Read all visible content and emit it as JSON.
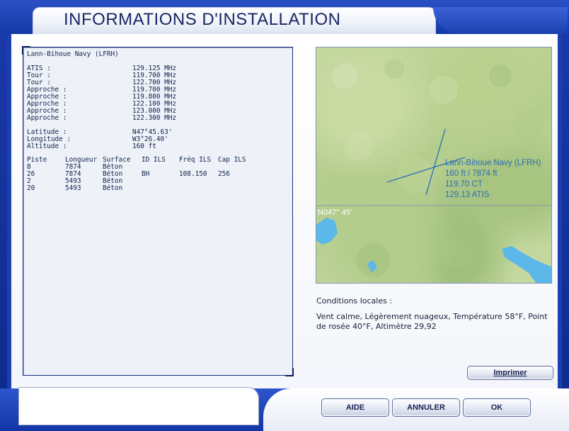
{
  "window": {
    "title": "INFORMATIONS D'INSTALLATION"
  },
  "airport": {
    "name": "Lann-Bihoue Navy (LFRH)",
    "freqs": [
      {
        "label": "ATIS :",
        "value": "129.125 MHz"
      },
      {
        "label": "Tour :",
        "value": "119.700 MHz"
      },
      {
        "label": "Tour :",
        "value": "122.700 MHz"
      },
      {
        "label": "Approche :",
        "value": "119.700 MHz"
      },
      {
        "label": "Approche :",
        "value": "119.800 MHz"
      },
      {
        "label": "Approche :",
        "value": "122.100 MHz"
      },
      {
        "label": "Approche :",
        "value": "123.000 MHz"
      },
      {
        "label": "Approche :",
        "value": "122.300 MHz"
      }
    ],
    "position": [
      {
        "label": "Latitude :",
        "value": "N47°45.63'"
      },
      {
        "label": "Longitude :",
        "value": "W3°26.40'"
      },
      {
        "label": "Altitude :",
        "value": "160 ft"
      }
    ],
    "runway_headers": [
      "Piste",
      "Longueur",
      "Surface",
      "ID ILS",
      "Fréq ILS",
      "Cap ILS"
    ],
    "runways": [
      [
        "8",
        "7874",
        "Béton",
        "",
        "",
        ""
      ],
      [
        "26",
        "7874",
        "Béton",
        "BH",
        "108.150",
        "256"
      ],
      [
        "2",
        "5493",
        "Béton",
        "",
        "",
        ""
      ],
      [
        "20",
        "5493",
        "Béton",
        "",
        "",
        ""
      ]
    ]
  },
  "map": {
    "label_lines": [
      "Lann-Bihoue Navy (LFRH)",
      "160  ft / 7874  ft",
      "119.70 CT",
      "129.13 ATIS"
    ],
    "lat_label": "N047° 45'",
    "label_color": "#2a6fb8",
    "water_color": "#5bb8e8"
  },
  "conditions": {
    "title": "Conditions locales :",
    "text": "Vent calme, Légèrement nuageux, Température 58°F, Point de rosée 40°F, Altimètre 29,92"
  },
  "buttons": {
    "print": "Imprimer",
    "help": "AIDE",
    "cancel": "ANNULER",
    "ok": "OK"
  }
}
